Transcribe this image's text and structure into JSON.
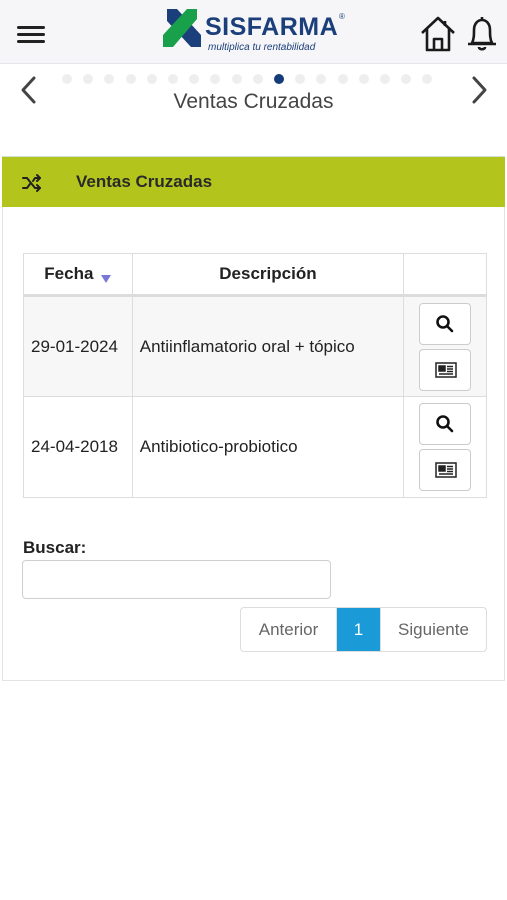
{
  "header": {
    "brand": "SISFARMA",
    "tagline": "multiplica tu rentabilidad",
    "registered": "®",
    "colors": {
      "brand_blue": "#1b3f7a",
      "brand_green": "#19a04b"
    }
  },
  "carousel": {
    "title": "Ventas Cruzadas",
    "dot_count": 18,
    "active_dot": 10,
    "colors": {
      "active": "#133c78",
      "inactive": "#eeeeee"
    }
  },
  "section": {
    "title": "Ventas Cruzadas",
    "icon": "shuffle-icon",
    "color": "#b3c51d"
  },
  "table": {
    "headers": {
      "fecha": "Fecha",
      "descripcion": "Descripción",
      "acciones": ""
    },
    "sort": "desc",
    "rows": [
      {
        "fecha": "29-01-2024",
        "descripcion": "Antiinflamatorio oral + tópico"
      },
      {
        "fecha": "24-04-2018",
        "descripcion": "Antibiotico-probiotico"
      }
    ],
    "row_actions": [
      "search-icon",
      "newspaper-icon"
    ]
  },
  "search": {
    "label": "Buscar:",
    "value": "",
    "placeholder": ""
  },
  "pagination": {
    "prev": "Anterior",
    "current": "1",
    "next": "Siguiente",
    "accent": "#1a9ad6"
  }
}
